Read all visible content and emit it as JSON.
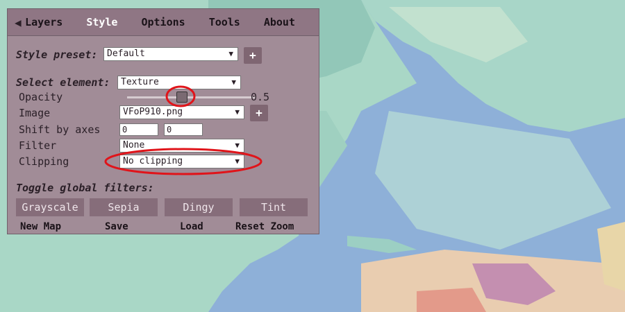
{
  "menu": {
    "back_icon": "back-triangle-icon",
    "items": [
      "Layers",
      "Style",
      "Options",
      "Tools",
      "About"
    ],
    "active": "Style"
  },
  "style_preset": {
    "label": "Style preset:",
    "value": "Default",
    "add": "+"
  },
  "select_element": {
    "label": "Select element:",
    "value": "Texture"
  },
  "opacity": {
    "label": "Opacity",
    "value": "0.5",
    "fraction": 0.5
  },
  "image": {
    "label": "Image",
    "value": "VFoP910.png",
    "add": "+"
  },
  "shift": {
    "label": "Shift by axes",
    "x": "0",
    "y": "0"
  },
  "filter": {
    "label": "Filter",
    "value": "None"
  },
  "clipping": {
    "label": "Clipping",
    "value": "No clipping"
  },
  "global_filters": {
    "label": "Toggle global filters:",
    "buttons": [
      "Grayscale",
      "Sepia",
      "Dingy",
      "Tint"
    ]
  },
  "footer": [
    "New Map",
    "Save",
    "Load",
    "Reset Zoom"
  ],
  "colors": {
    "panel": "#a18c97",
    "menu": "#8f7684",
    "highlight": "#e0141a"
  }
}
